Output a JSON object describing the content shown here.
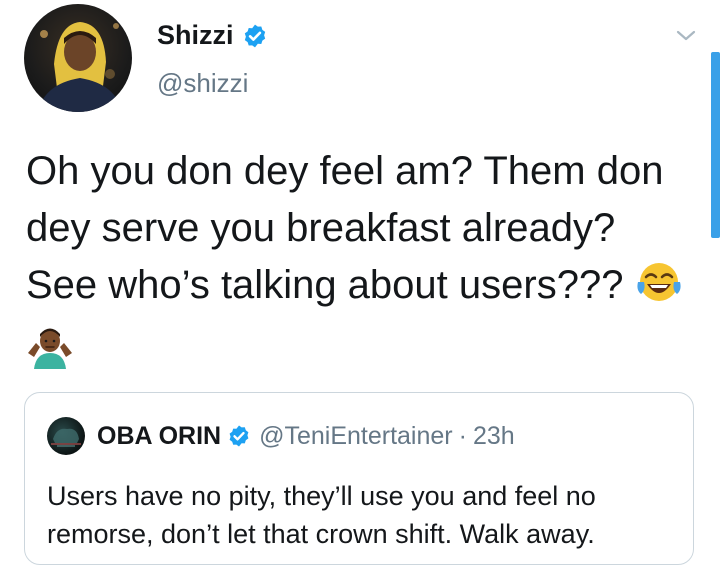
{
  "tweet": {
    "author_name": "Shizzi",
    "author_handle": "@shizzi",
    "text": "Oh you don dey feel am? Them don dey serve you breakfast already? See who’s talking about users???",
    "emojis": [
      "face-with-tears-of-joy-emoji",
      "man-shrugging-emoji"
    ]
  },
  "quoted_tweet": {
    "author_name": "OBA ORIN",
    "author_handle": "@TeniEntertainer",
    "separator": "·",
    "time": "23h",
    "text": "Users have no pity, they’ll use you and feel no remorse, don’t let that crown shift. Walk away."
  },
  "colors": {
    "verified_blue": "#1da1f2",
    "secondary_text": "#657786",
    "border": "#ccd6dd",
    "scrollbar": "#3aa0e8"
  }
}
